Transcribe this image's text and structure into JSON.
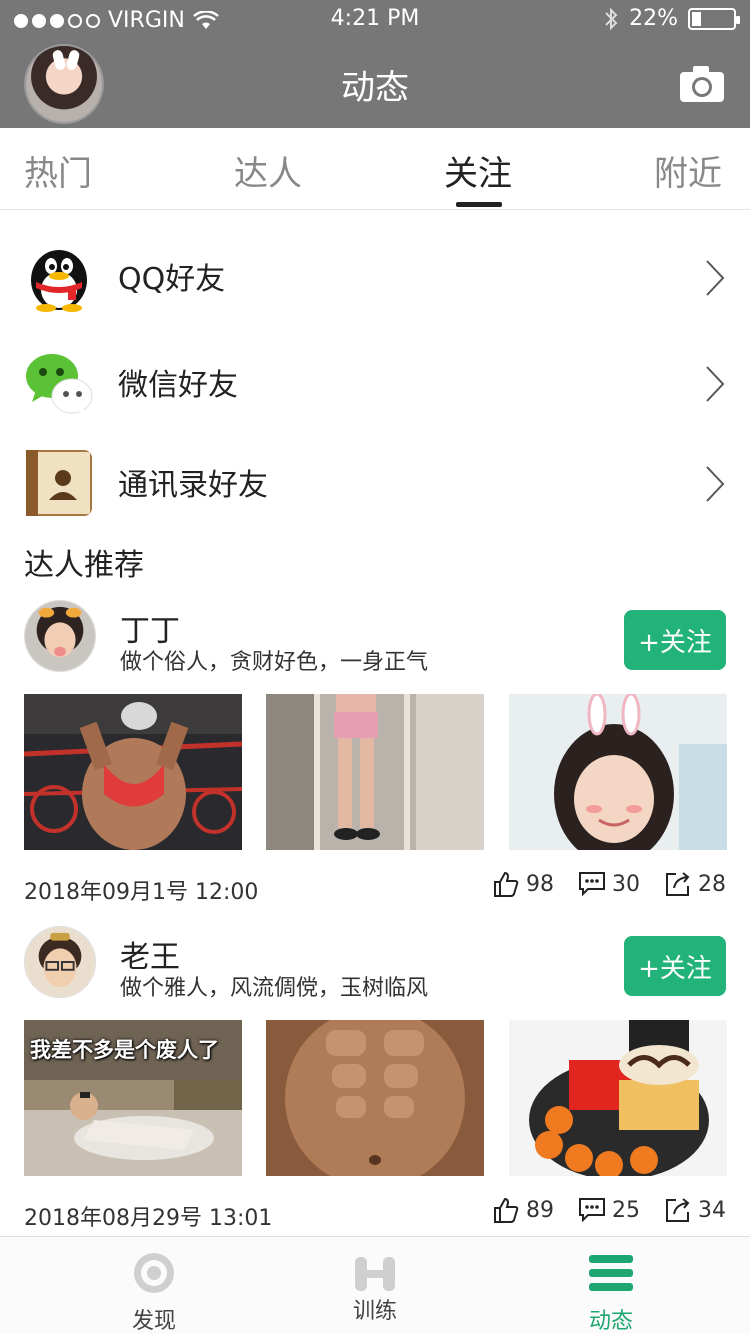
{
  "status_bar": {
    "carrier": "VIRGIN",
    "time": "4:21 PM",
    "battery": "22%",
    "battery_level": 0.22
  },
  "header": {
    "title": "动态"
  },
  "tabs": [
    {
      "label": "热门"
    },
    {
      "label": "达人"
    },
    {
      "label": "关注",
      "active": true
    },
    {
      "label": "附近"
    }
  ],
  "friends": [
    {
      "label": "QQ好友",
      "icon": "qq-icon"
    },
    {
      "label": "微信好友",
      "icon": "wechat-icon"
    },
    {
      "label": "通讯录好友",
      "icon": "contacts-icon"
    }
  ],
  "section_title": "达人推荐",
  "posts": [
    {
      "name": "丁丁",
      "motto": "做个俗人，贪财好色，一身正气",
      "follow_label": "+关注",
      "date": "2018年09月1号  12:00",
      "likes": "98",
      "comments": "30",
      "shares": "28",
      "photo_caption": ""
    },
    {
      "name": "老王",
      "motto": "做个雅人，风流倜傥，玉树临风",
      "follow_label": "+关注",
      "date": "2018年08月29号  13:01",
      "likes": "89",
      "comments": "25",
      "shares": "34",
      "photo_caption": "我差不多是个废人了"
    }
  ],
  "bottom_nav": [
    {
      "label": "发现",
      "icon": "target-icon"
    },
    {
      "label": "训练",
      "icon": "dumbbell-icon"
    },
    {
      "label": "动态",
      "icon": "menu-icon",
      "active": true
    }
  ],
  "colors": {
    "header_bg": "#777777",
    "accent": "#22b37a",
    "active_nav": "#1ea672"
  }
}
